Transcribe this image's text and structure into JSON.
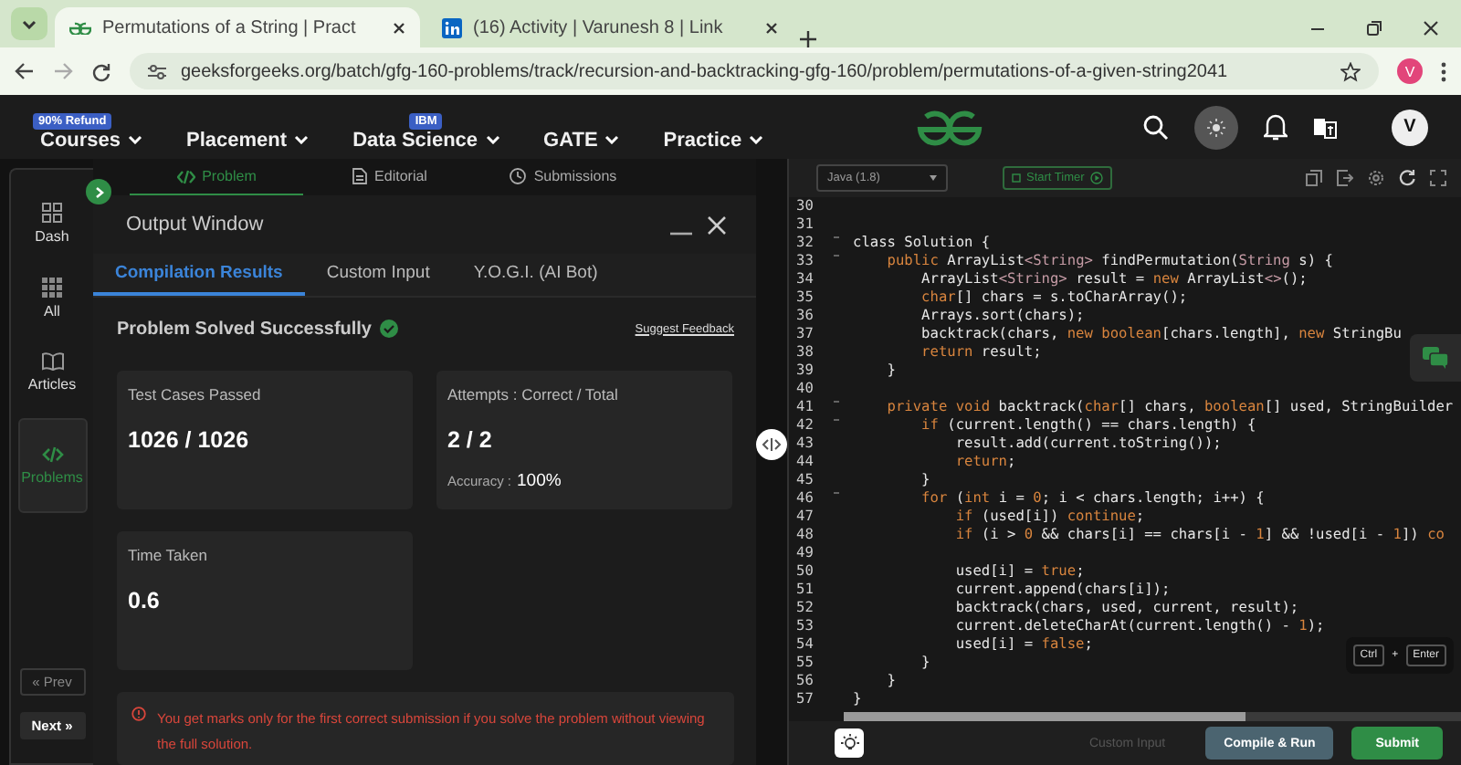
{
  "browser": {
    "tabs": [
      {
        "title": "Permutations of a String | Pract",
        "selected": true,
        "kind": "gfg"
      },
      {
        "title": "(16) Activity | Varunesh 8 | Link",
        "selected": false,
        "kind": "linkedin"
      }
    ],
    "url": "geeksforgeeks.org/batch/gfg-160-problems/track/recursion-and-backtracking-gfg-160/problem/permutations-of-a-given-string2041",
    "profile": "V"
  },
  "site_nav": {
    "items": [
      {
        "label": "Courses",
        "badge": "90% Refund"
      },
      {
        "label": "Placement"
      },
      {
        "label": "Data Science",
        "badge": "IBM"
      },
      {
        "label": "GATE"
      },
      {
        "label": "Practice"
      }
    ],
    "avatar": "V"
  },
  "sidebar": {
    "items": [
      {
        "label": "Dash",
        "kind": "dash",
        "selected": false
      },
      {
        "label": "All",
        "kind": "all",
        "selected": false
      },
      {
        "label": "Articles",
        "kind": "articles",
        "selected": false
      },
      {
        "label": "Problems",
        "kind": "problems",
        "selected": true
      }
    ],
    "prev": "« Prev",
    "next": "Next »"
  },
  "problem_tabs": [
    {
      "label": "Problem",
      "kind": "code",
      "selected": true
    },
    {
      "label": "Editorial",
      "kind": "doc",
      "selected": false
    },
    {
      "label": "Submissions",
      "kind": "clock",
      "selected": false
    }
  ],
  "output_window": {
    "title": "Output Window",
    "tabs": [
      {
        "label": "Compilation Results",
        "selected": true
      },
      {
        "label": "Custom Input",
        "selected": false
      },
      {
        "label": "Y.O.G.I. (AI Bot)",
        "selected": false
      }
    ],
    "status": "Problem Solved Successfully",
    "feedback": "Suggest Feedback",
    "cards": [
      {
        "label": "Test Cases Passed",
        "value": "1026 / 1026"
      },
      {
        "label": "Attempts : Correct / Total",
        "value": "2 / 2",
        "extra_label": "Accuracy :",
        "extra_value": "100%"
      },
      {
        "label": "Time Taken",
        "value": "0.6"
      }
    ],
    "notice": "You get marks only for the first correct submission if you solve the problem without viewing the full solution."
  },
  "editor": {
    "language": "Java (1.8)",
    "timer": "Start Timer",
    "lines": [
      {
        "number": "30",
        "fold": false
      },
      {
        "number": "31",
        "fold": false
      },
      {
        "number": "32",
        "fold": true,
        "tokens": [
          {
            "text": "class Solution {",
            "kind": "plain"
          }
        ]
      },
      {
        "number": "33",
        "fold": true,
        "tokens": [
          {
            "text": "    public",
            "kind": "kw"
          },
          {
            "text": " ArrayList",
            "kind": "plain"
          },
          {
            "text": "<String>",
            "kind": "type"
          },
          {
            "text": " findPermutation(",
            "kind": "plain"
          },
          {
            "text": "String",
            "kind": "type"
          },
          {
            "text": " s) {",
            "kind": "plain"
          }
        ]
      },
      {
        "number": "34",
        "fold": false,
        "tokens": [
          {
            "text": "        ArrayList",
            "kind": "plain"
          },
          {
            "text": "<String>",
            "kind": "type"
          },
          {
            "text": " result = ",
            "kind": "plain"
          },
          {
            "text": "new",
            "kind": "kw"
          },
          {
            "text": " ArrayList",
            "kind": "plain"
          },
          {
            "text": "<>",
            "kind": "type"
          },
          {
            "text": "();",
            "kind": "plain"
          }
        ]
      },
      {
        "number": "35",
        "fold": false,
        "tokens": [
          {
            "text": "        char",
            "kind": "kw"
          },
          {
            "text": "[] chars = s.toCharArray();",
            "kind": "plain"
          }
        ]
      },
      {
        "number": "36",
        "fold": false,
        "tokens": [
          {
            "text": "        Arrays.sort(chars);",
            "kind": "plain"
          }
        ]
      },
      {
        "number": "37",
        "fold": false,
        "tokens": [
          {
            "text": "        backtrack(chars, ",
            "kind": "plain"
          },
          {
            "text": "new boolean",
            "kind": "kw"
          },
          {
            "text": "[chars.length], ",
            "kind": "plain"
          },
          {
            "text": "new",
            "kind": "kw"
          },
          {
            "text": " StringBu",
            "kind": "plain"
          }
        ]
      },
      {
        "number": "38",
        "fold": false,
        "tokens": [
          {
            "text": "        return",
            "kind": "kw"
          },
          {
            "text": " result;",
            "kind": "plain"
          }
        ]
      },
      {
        "number": "39",
        "fold": false,
        "tokens": [
          {
            "text": "    }",
            "kind": "plain"
          }
        ]
      },
      {
        "number": "40",
        "fold": false
      },
      {
        "number": "41",
        "fold": true,
        "tokens": [
          {
            "text": "    private void",
            "kind": "kw"
          },
          {
            "text": " backtrack(",
            "kind": "plain"
          },
          {
            "text": "char",
            "kind": "kw"
          },
          {
            "text": "[] chars, ",
            "kind": "plain"
          },
          {
            "text": "boolean",
            "kind": "kw"
          },
          {
            "text": "[] used, StringBuilder",
            "kind": "plain"
          }
        ]
      },
      {
        "number": "42",
        "fold": true,
        "tokens": [
          {
            "text": "        if",
            "kind": "kw"
          },
          {
            "text": " (current.length() == chars.length) {",
            "kind": "plain"
          }
        ]
      },
      {
        "number": "43",
        "fold": false,
        "tokens": [
          {
            "text": "            result.add(current.toString());",
            "kind": "plain"
          }
        ]
      },
      {
        "number": "44",
        "fold": false,
        "tokens": [
          {
            "text": "            return",
            "kind": "kw"
          },
          {
            "text": ";",
            "kind": "plain"
          }
        ]
      },
      {
        "number": "45",
        "fold": false,
        "tokens": [
          {
            "text": "        }",
            "kind": "plain"
          }
        ]
      },
      {
        "number": "46",
        "fold": true,
        "tokens": [
          {
            "text": "        for",
            "kind": "kw"
          },
          {
            "text": " (",
            "kind": "plain"
          },
          {
            "text": "int",
            "kind": "kw"
          },
          {
            "text": " i = ",
            "kind": "plain"
          },
          {
            "text": "0",
            "kind": "num"
          },
          {
            "text": "; i < chars.length; i++) {",
            "kind": "plain"
          }
        ]
      },
      {
        "number": "47",
        "fold": false,
        "tokens": [
          {
            "text": "            if",
            "kind": "kw"
          },
          {
            "text": " (used[i]) ",
            "kind": "plain"
          },
          {
            "text": "continue",
            "kind": "kw"
          },
          {
            "text": ";",
            "kind": "plain"
          }
        ]
      },
      {
        "number": "48",
        "fold": false,
        "tokens": [
          {
            "text": "            if",
            "kind": "kw"
          },
          {
            "text": " (i > ",
            "kind": "plain"
          },
          {
            "text": "0",
            "kind": "num"
          },
          {
            "text": " && chars[i] == chars[i - ",
            "kind": "plain"
          },
          {
            "text": "1",
            "kind": "num"
          },
          {
            "text": "] && !used[i - ",
            "kind": "plain"
          },
          {
            "text": "1",
            "kind": "num"
          },
          {
            "text": "]) ",
            "kind": "plain"
          },
          {
            "text": "co",
            "kind": "kw"
          }
        ]
      },
      {
        "number": "49",
        "fold": false
      },
      {
        "number": "50",
        "fold": false,
        "tokens": [
          {
            "text": "            used[i] = ",
            "kind": "plain"
          },
          {
            "text": "true",
            "kind": "kw"
          },
          {
            "text": ";",
            "kind": "plain"
          }
        ]
      },
      {
        "number": "51",
        "fold": false,
        "tokens": [
          {
            "text": "            current.append(chars[i]);",
            "kind": "plain"
          }
        ]
      },
      {
        "number": "52",
        "fold": false,
        "tokens": [
          {
            "text": "            backtrack(chars, used, current, result);",
            "kind": "plain"
          }
        ]
      },
      {
        "number": "53",
        "fold": false,
        "tokens": [
          {
            "text": "            current.deleteCharAt(current.length() - ",
            "kind": "plain"
          },
          {
            "text": "1",
            "kind": "num"
          },
          {
            "text": ");",
            "kind": "plain"
          }
        ]
      },
      {
        "number": "54",
        "fold": false,
        "tokens": [
          {
            "text": "            used[i] = ",
            "kind": "plain"
          },
          {
            "text": "false",
            "kind": "kw"
          },
          {
            "text": ";",
            "kind": "plain"
          }
        ]
      },
      {
        "number": "55",
        "fold": false,
        "tokens": [
          {
            "text": "        }",
            "kind": "plain"
          }
        ]
      },
      {
        "number": "56",
        "fold": false,
        "tokens": [
          {
            "text": "    }",
            "kind": "plain"
          }
        ]
      },
      {
        "number": "57",
        "fold": false,
        "tokens": [
          {
            "text": "}",
            "kind": "plain"
          }
        ]
      }
    ],
    "shortcut": {
      "keys": [
        "Ctrl",
        "Enter"
      ],
      "joiner": "+"
    },
    "buttons": [
      {
        "label": "Custom Input",
        "kind": "plain",
        "disabled": true
      },
      {
        "label": "Compile & Run",
        "kind": "secondary",
        "disabled": false
      },
      {
        "label": "Submit",
        "kind": "primary",
        "disabled": false
      }
    ]
  }
}
